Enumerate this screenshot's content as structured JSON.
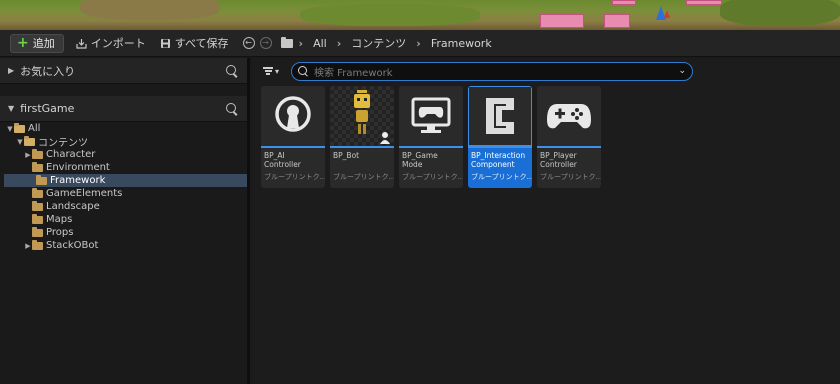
{
  "toolbar": {
    "add_label": "追加",
    "import_label": "インポート",
    "save_all_label": "すべて保存",
    "breadcrumb": [
      "All",
      "コンテンツ",
      "Framework"
    ]
  },
  "sidebar": {
    "favorites_label": "お気に入り",
    "project_label": "firstGame",
    "tree": [
      {
        "label": "All",
        "depth": 0,
        "expanded": true
      },
      {
        "label": "コンテンツ",
        "depth": 1,
        "expanded": true
      },
      {
        "label": "Character",
        "depth": 2,
        "expandable": true
      },
      {
        "label": "Environment",
        "depth": 2
      },
      {
        "label": "Framework",
        "depth": 2,
        "selected": true
      },
      {
        "label": "GameElements",
        "depth": 2
      },
      {
        "label": "Landscape",
        "depth": 2
      },
      {
        "label": "Maps",
        "depth": 2
      },
      {
        "label": "Props",
        "depth": 2
      },
      {
        "label": "StackOBot",
        "depth": 2,
        "expandable": true
      }
    ]
  },
  "search": {
    "placeholder": "検索 Framework"
  },
  "assets": [
    {
      "name": "BP_AI Controller",
      "type": "ブループリントク...",
      "icon": "ai-controller-icon"
    },
    {
      "name": "BP_Bot",
      "type": "ブループリントク...",
      "icon": "robot-character-icon"
    },
    {
      "name": "BP_Game Mode",
      "type": "ブループリントク...",
      "icon": "game-mode-icon"
    },
    {
      "name": "BP_Interaction Component",
      "type": "ブループリントク...",
      "icon": "component-icon",
      "selected": true
    },
    {
      "name": "BP_Player Controller",
      "type": "ブループリントク...",
      "icon": "gamepad-icon"
    }
  ],
  "colors": {
    "accent": "#3f8ee8",
    "selection": "#1a6fd6",
    "folder": "#c09a55",
    "add_plus": "#6fd04b"
  }
}
